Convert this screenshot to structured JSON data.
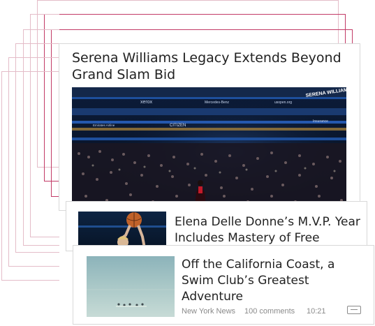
{
  "colors": {
    "stack_outline_light": "#e4bcc8",
    "stack_outline_dark": "#c23a66",
    "card_border": "#d8d8d8",
    "headline_text": "#222222",
    "meta_text": "#8a8a8a"
  },
  "cards": {
    "main": {
      "title": "Serena Williams Legacy Extends Beyond Grand Slam Bid",
      "photo": {
        "signage": [
          "xerox",
          "Mercedes-Benz",
          "CITIZEN",
          "SERENA WILLIAMS",
          "usopen.org",
          "Emirates Airline",
          "Insurance"
        ]
      }
    },
    "middle": {
      "headline": "Elena Delle Donne’s M.V.P. Year Includes Mastery of Free Throws"
    },
    "front": {
      "headline": "Off the California Coast, a Swim Club’s Greatest Adventure",
      "source": "New York News",
      "comments": "100 comments",
      "time": "10:21",
      "collapse_icon": "minus-box-icon"
    }
  }
}
